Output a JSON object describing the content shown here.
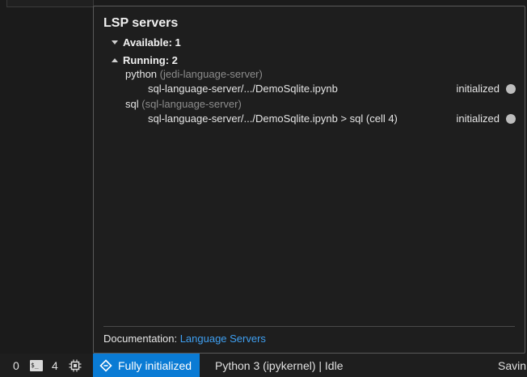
{
  "popup": {
    "title": "LSP servers",
    "available_label": "Available: 1",
    "running_label": "Running: 2",
    "servers": [
      {
        "name": "python",
        "impl": "(jedi-language-server)",
        "doc": "sql-language-server/.../DemoSqlite.ipynb",
        "status": "initialized"
      },
      {
        "name": "sql",
        "impl": "(sql-language-server)",
        "doc": "sql-language-server/.../DemoSqlite.ipynb > sql (cell 4)",
        "status": "initialized"
      }
    ],
    "doc_prefix": "Documentation:",
    "doc_link": "Language Servers"
  },
  "statusbar": {
    "count_a": "0",
    "count_b": "4",
    "lsp_status": "Fully initialized",
    "kernel": "Python 3 (ipykernel) | Idle",
    "saving": "Savin"
  },
  "colors": {
    "accent": "#0a7bd4",
    "link": "#3fa0f2",
    "status_dot": "#bdbdbd"
  },
  "icons": [
    "caret-down-icon",
    "caret-up-icon",
    "status-dot-icon",
    "terminal-icon",
    "chip-icon",
    "lsp-plug-icon"
  ]
}
